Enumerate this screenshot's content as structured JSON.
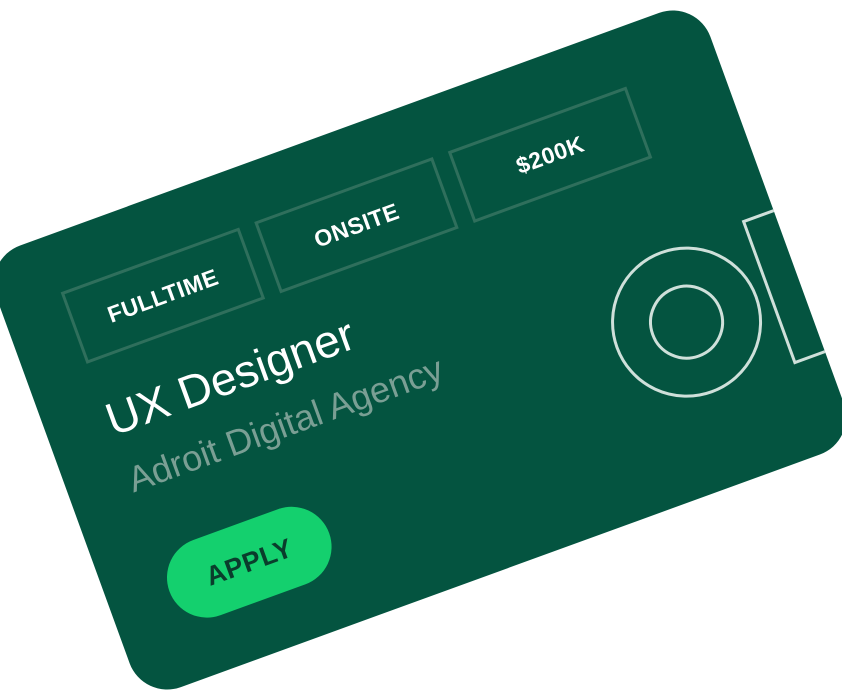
{
  "job_card": {
    "tags": [
      "FULLTIME",
      "ONSITE",
      "$200K"
    ],
    "title": "UX Designer",
    "company": "Adroit Digital Agency",
    "apply_label": "APPLY"
  },
  "colors": {
    "card_background": "#045440",
    "tag_border": "#2f6f5c",
    "company_text": "#7a9f94",
    "apply_button": "#14d06e",
    "apply_text": "#0a3d2c",
    "watermark_stroke": "#cfe0da"
  }
}
